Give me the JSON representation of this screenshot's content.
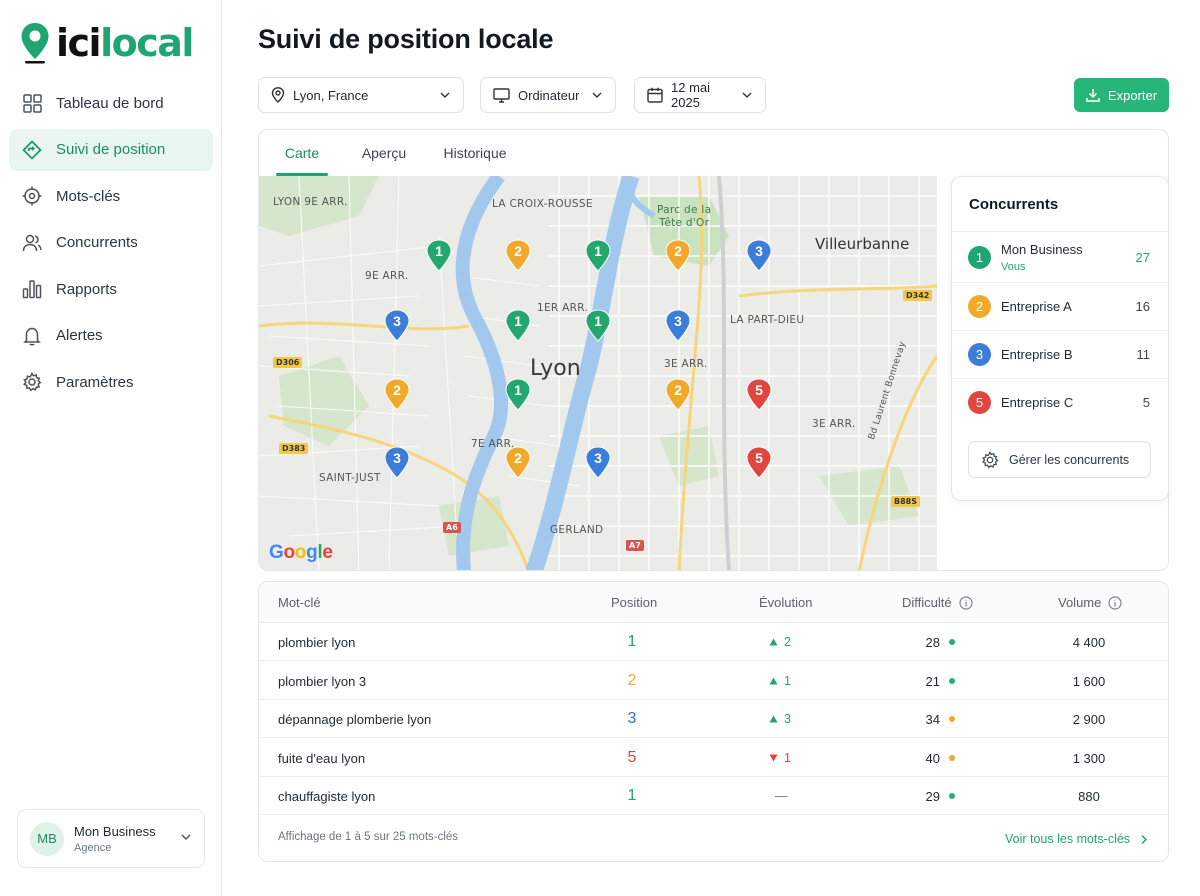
{
  "brand": {
    "name_part1": "ici",
    "name_part2": "local",
    "accent": "#1fa572"
  },
  "sidebar": {
    "items": [
      {
        "label": "Tableau de bord",
        "icon": "grid-icon"
      },
      {
        "label": "Suivi de position",
        "icon": "diamond-icon",
        "active": true
      },
      {
        "label": "Mots-clés",
        "icon": "target-icon"
      },
      {
        "label": "Concurrents",
        "icon": "users-icon"
      },
      {
        "label": "Rapports",
        "icon": "bar-chart-icon"
      },
      {
        "label": "Alertes",
        "icon": "bell-icon"
      },
      {
        "label": "Paramètres",
        "icon": "gear-icon"
      }
    ],
    "account": {
      "initials": "MB",
      "name": "Mon Business",
      "role": "Agence"
    }
  },
  "header": {
    "title": "Suivi de position locale",
    "location": "Lyon, France",
    "device": "Ordinateur",
    "date": "12 mai 2025",
    "export_label": "Exporter"
  },
  "tabs": [
    {
      "label": "Carte",
      "active": true
    },
    {
      "label": "Aperçu"
    },
    {
      "label": "Historique"
    }
  ],
  "map": {
    "labels": {
      "lyon9": "LYON 9E ARR.",
      "croix": "LA CROIX-ROUSSE",
      "park1": "Parc de la",
      "park2": "Tête d'Or",
      "villeurbanne": "Villeurbanne",
      "arr9": "9E ARR.",
      "arr1": "1ER ARR.",
      "partdieu": "LA PART-DIEU",
      "lyon": "Lyon",
      "arr3a": "3E ARR.",
      "arr3b": "3E ARR.",
      "arr7": "7E ARR.",
      "saintjust": "SAINT-JUST",
      "gerland": "GERLAND",
      "blvd": "Bd Laurent Bonnevay",
      "d306": "D306",
      "d342": "D342",
      "d383": "D383",
      "a6": "A6",
      "a7": "A7",
      "b88s": "B88S",
      "google": "Google"
    },
    "pins": [
      {
        "rank": "1"
      },
      {
        "rank": "2"
      },
      {
        "rank": "1"
      },
      {
        "rank": "2"
      },
      {
        "rank": "3"
      },
      {
        "rank": "3"
      },
      {
        "rank": "1"
      },
      {
        "rank": "1"
      },
      {
        "rank": "3"
      },
      {
        "rank": "2"
      },
      {
        "rank": "1"
      },
      {
        "rank": "2"
      },
      {
        "rank": "5"
      },
      {
        "rank": "3"
      },
      {
        "rank": "2"
      },
      {
        "rank": "3"
      },
      {
        "rank": "5"
      }
    ]
  },
  "competitors": {
    "title": "Concurrents",
    "items": [
      {
        "rank": "1",
        "name": "Mon Business",
        "sub": "Vous",
        "score": "27",
        "color": "#1fa572"
      },
      {
        "rank": "2",
        "name": "Entreprise A",
        "score": "16",
        "color": "#f0a92a"
      },
      {
        "rank": "3",
        "name": "Entreprise B",
        "score": "11",
        "color": "#3b7dd8"
      },
      {
        "rank": "5",
        "name": "Entreprise C",
        "score": "5",
        "color": "#e0463f"
      }
    ],
    "manage_label": "Gérer les concurrents"
  },
  "table": {
    "headers": {
      "keyword": "Mot-clé",
      "position": "Position",
      "evolution": "Évolution",
      "difficulty": "Difficulté",
      "volume": "Volume"
    },
    "rows": [
      {
        "keyword": "plombier lyon",
        "position": "1",
        "evo_dir": "up",
        "evo": "2",
        "difficulty": "28",
        "volume": "4 400"
      },
      {
        "keyword": "plombier lyon 3",
        "position": "2",
        "evo_dir": "up",
        "evo": "1",
        "difficulty": "21",
        "volume": "1 600"
      },
      {
        "keyword": "dépannage plomberie lyon",
        "position": "3",
        "evo_dir": "up",
        "evo": "3",
        "difficulty": "34",
        "volume": "2 900"
      },
      {
        "keyword": "fuite d'eau lyon",
        "position": "5",
        "evo_dir": "down",
        "evo": "1",
        "difficulty": "40",
        "volume": "1 300"
      },
      {
        "keyword": "chauffagiste lyon",
        "position": "1",
        "evo_dir": "flat",
        "evo": "—",
        "difficulty": "29",
        "volume": "880"
      }
    ],
    "footer": "Affichage de 1 à 5 sur 25 mots-clés",
    "view_all": "Voir tous les mots-clés"
  },
  "colors": {
    "green": "#1fa572",
    "orange": "#f0a92a",
    "blue": "#3b7dd8",
    "red": "#e0463f"
  }
}
